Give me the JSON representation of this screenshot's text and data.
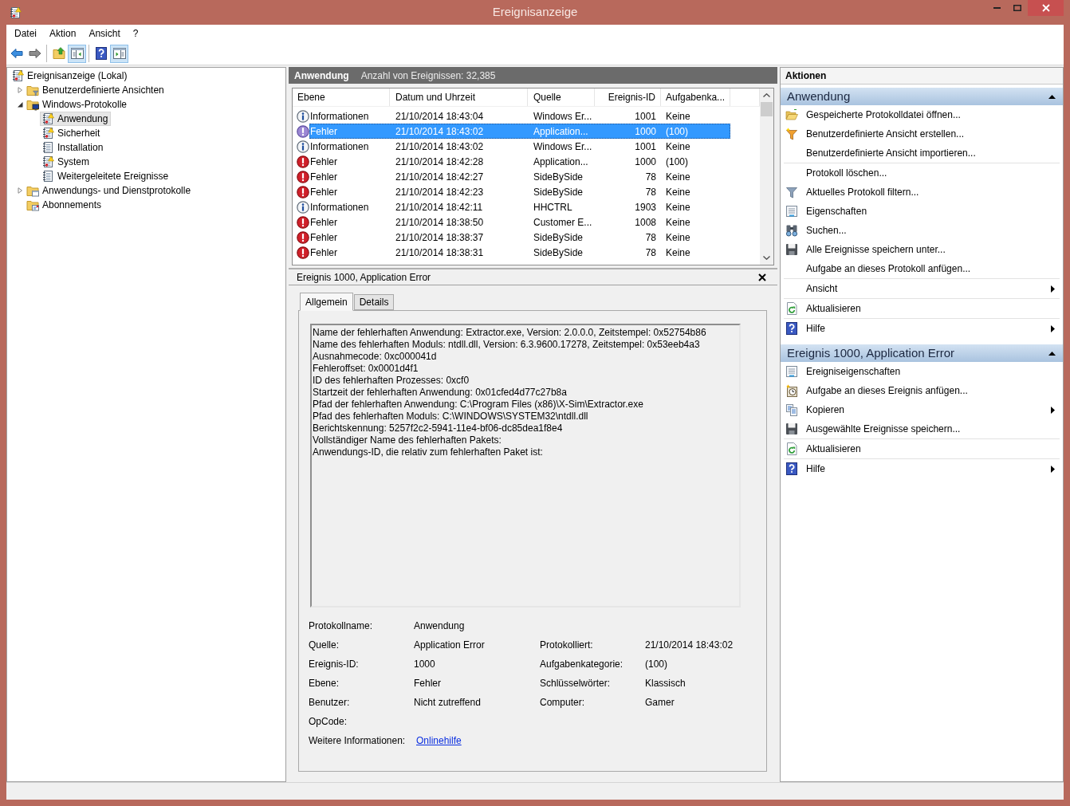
{
  "window": {
    "title": "Ereignisanzeige"
  },
  "menu": [
    "Datei",
    "Aktion",
    "Ansicht",
    "?"
  ],
  "toolbar": {
    "groups": [
      [
        {
          "kind": "back",
          "pressed": false
        },
        {
          "kind": "forward",
          "pressed": false
        }
      ],
      [
        {
          "kind": "up",
          "pressed": false
        },
        {
          "kind": "console-tree",
          "pressed": true
        }
      ],
      [
        {
          "kind": "help",
          "pressed": false
        },
        {
          "kind": "action-pane",
          "pressed": true
        }
      ]
    ]
  },
  "tree": {
    "items": [
      {
        "label": "Ereignisanzeige (Lokal)",
        "kind": "root",
        "selected": false,
        "children": [
          {
            "label": "Benutzerdefinierte Ansichten",
            "kind": "folder-filter",
            "expanded": false,
            "selected": false
          },
          {
            "label": "Windows-Protokolle",
            "kind": "folder-monitor",
            "expanded": true,
            "selected": false,
            "children": [
              {
                "label": "Anwendung",
                "kind": "log-alert",
                "selected": true
              },
              {
                "label": "Sicherheit",
                "kind": "log-alert",
                "selected": false
              },
              {
                "label": "Installation",
                "kind": "log",
                "selected": false
              },
              {
                "label": "System",
                "kind": "log-alert",
                "selected": false
              },
              {
                "label": "Weitergeleitete Ereignisse",
                "kind": "log",
                "selected": false
              }
            ]
          },
          {
            "label": "Anwendungs- und Dienstprotokolle",
            "kind": "folder-window",
            "expanded": false,
            "selected": false
          },
          {
            "label": "Abonnements",
            "kind": "folder-card",
            "selected": false
          }
        ]
      }
    ]
  },
  "event_list": {
    "title": "Anwendung",
    "count": "Anzahl von Ereignissen: 32,385",
    "columns": [
      "Ebene",
      "Datum und Uhrzeit",
      "Quelle",
      "Ereignis-ID",
      "Aufgabenka..."
    ],
    "rows": [
      {
        "kind": "info",
        "severity": "Informationen",
        "datetime": "21/10/2014 18:43:04",
        "source": "Windows Er...",
        "event_id": "1001",
        "task": "Keine",
        "selected": false
      },
      {
        "kind": "error",
        "severity": "Fehler",
        "datetime": "21/10/2014 18:43:02",
        "source": "Application...",
        "event_id": "1000",
        "task": "(100)",
        "selected": true
      },
      {
        "kind": "info",
        "severity": "Informationen",
        "datetime": "21/10/2014 18:43:02",
        "source": "Windows Er...",
        "event_id": "1001",
        "task": "Keine",
        "selected": false
      },
      {
        "kind": "error",
        "severity": "Fehler",
        "datetime": "21/10/2014 18:42:28",
        "source": "Application...",
        "event_id": "1000",
        "task": "(100)",
        "selected": false
      },
      {
        "kind": "error",
        "severity": "Fehler",
        "datetime": "21/10/2014 18:42:27",
        "source": "SideBySide",
        "event_id": "78",
        "task": "Keine",
        "selected": false
      },
      {
        "kind": "error",
        "severity": "Fehler",
        "datetime": "21/10/2014 18:42:23",
        "source": "SideBySide",
        "event_id": "78",
        "task": "Keine",
        "selected": false
      },
      {
        "kind": "info",
        "severity": "Informationen",
        "datetime": "21/10/2014 18:42:11",
        "source": "HHCTRL",
        "event_id": "1903",
        "task": "Keine",
        "selected": false
      },
      {
        "kind": "error",
        "severity": "Fehler",
        "datetime": "21/10/2014 18:38:50",
        "source": "Customer E...",
        "event_id": "1008",
        "task": "Keine",
        "selected": false
      },
      {
        "kind": "error",
        "severity": "Fehler",
        "datetime": "21/10/2014 18:38:37",
        "source": "SideBySide",
        "event_id": "78",
        "task": "Keine",
        "selected": false
      },
      {
        "kind": "error",
        "severity": "Fehler",
        "datetime": "21/10/2014 18:38:31",
        "source": "SideBySide",
        "event_id": "78",
        "task": "Keine",
        "selected": false
      }
    ]
  },
  "event_detail": {
    "title": "Ereignis 1000, Application Error",
    "tabs": [
      {
        "label": "Allgemein",
        "selected": true
      },
      {
        "label": "Details",
        "selected": false
      }
    ],
    "description": [
      "Name der fehlerhaften Anwendung: Extractor.exe, Version: 2.0.0.0, Zeitstempel: 0x52754b86",
      "Name des fehlerhaften Moduls: ntdll.dll, Version: 6.3.9600.17278, Zeitstempel: 0x53eeb4a3",
      "Ausnahmecode: 0xc000041d",
      "Fehleroffset: 0x0001d4f1",
      "ID des fehlerhaften Prozesses: 0xcf0",
      "Startzeit der fehlerhaften Anwendung: 0x01cfed4d77c27b8a",
      "Pfad der fehlerhaften Anwendung: C:\\Program Files (x86)\\X-Sim\\Extractor.exe",
      "Pfad des fehlerhaften Moduls: C:\\WINDOWS\\SYSTEM32\\ntdll.dll",
      "Berichtskennung: 5257f2c2-5941-11e4-bf06-dc85dea1f8e4",
      "Vollständiger Name des fehlerhaften Pakets:",
      "Anwendungs-ID, die relativ zum fehlerhaften Paket ist:"
    ],
    "fields": [
      [
        {
          "label": "Protokollname:",
          "value": "Anwendung"
        }
      ],
      [
        {
          "label": "Quelle:",
          "value": "Application Error"
        },
        {
          "label": "Protokolliert:",
          "value": "21/10/2014 18:43:02"
        }
      ],
      [
        {
          "label": "Ereignis-ID:",
          "value": "1000"
        },
        {
          "label": "Aufgabenkategorie:",
          "value": "(100)"
        }
      ],
      [
        {
          "label": "Ebene:",
          "value": "Fehler"
        },
        {
          "label": "Schlüsselwörter:",
          "value": "Klassisch"
        }
      ],
      [
        {
          "label": "Benutzer:",
          "value": "Nicht zutreffend"
        },
        {
          "label": "Computer:",
          "value": "Gamer"
        }
      ],
      [
        {
          "label": "OpCode:"
        }
      ],
      [
        {
          "label": "Weitere Informationen:",
          "link": "Onlinehilfe"
        }
      ]
    ]
  },
  "actions": {
    "title": "Aktionen",
    "sections": [
      {
        "title": "Anwendung",
        "expanded": true,
        "groups": [
          [
            {
              "label": "Gespeicherte Protokolldatei öffnen...",
              "kind": "open-log",
              "submenu": false
            },
            {
              "label": "Benutzerdefinierte Ansicht erstellen...",
              "kind": "filter-new",
              "submenu": false
            },
            {
              "label": "Benutzerdefinierte Ansicht importieren...",
              "kind": "plain",
              "submenu": false
            }
          ],
          [
            {
              "label": "Protokoll löschen...",
              "kind": "plain",
              "submenu": false
            },
            {
              "label": "Aktuelles Protokoll filtern...",
              "kind": "filter",
              "submenu": false
            },
            {
              "label": "Eigenschaften",
              "kind": "properties",
              "submenu": false
            },
            {
              "label": "Suchen...",
              "kind": "find",
              "submenu": false
            },
            {
              "label": "Alle Ereignisse speichern unter...",
              "kind": "save",
              "submenu": false
            },
            {
              "label": "Aufgabe an dieses Protokoll anfügen...",
              "kind": "plain",
              "submenu": false
            }
          ],
          [
            {
              "label": "Ansicht",
              "kind": "plain",
              "submenu": true
            }
          ],
          [
            {
              "label": "Aktualisieren",
              "kind": "refresh",
              "submenu": false
            }
          ],
          [
            {
              "label": "Hilfe",
              "kind": "help",
              "submenu": true
            }
          ]
        ]
      },
      {
        "title": "Ereignis 1000, Application Error",
        "expanded": true,
        "groups": [
          [
            {
              "label": "Ereigniseigenschaften",
              "kind": "properties",
              "submenu": false
            },
            {
              "label": "Aufgabe an dieses Ereignis anfügen...",
              "kind": "task",
              "submenu": false
            },
            {
              "label": "Kopieren",
              "kind": "copy",
              "submenu": true
            },
            {
              "label": "Ausgewählte Ereignisse speichern...",
              "kind": "save",
              "submenu": false
            }
          ],
          [
            {
              "label": "Aktualisieren",
              "kind": "refresh",
              "submenu": false
            }
          ],
          [
            {
              "label": "Hilfe",
              "kind": "help",
              "submenu": true
            }
          ]
        ]
      }
    ]
  }
}
